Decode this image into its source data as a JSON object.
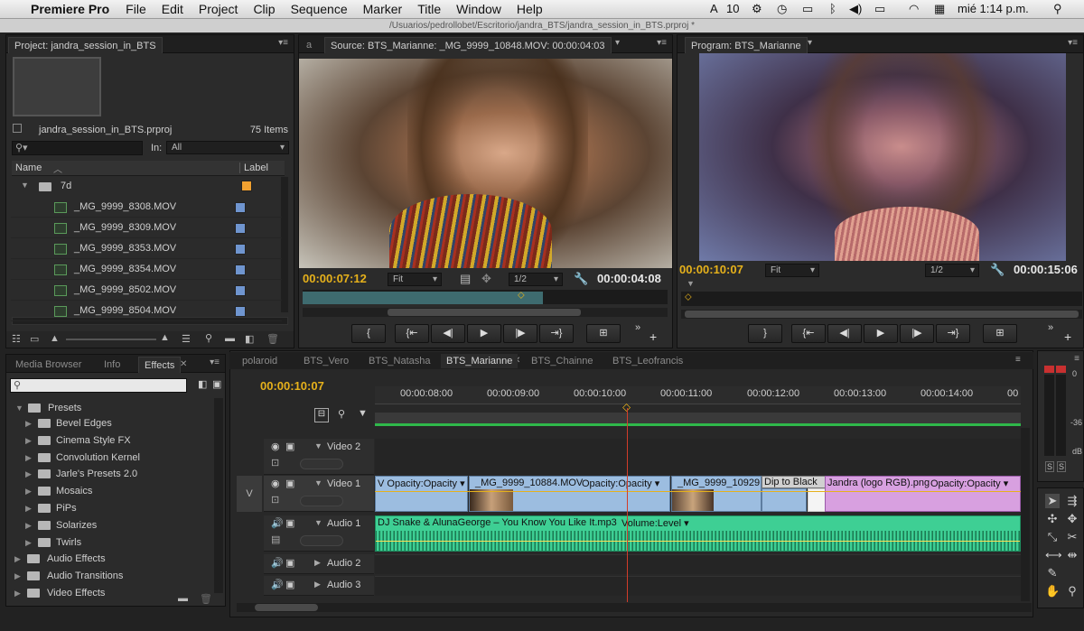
{
  "menubar": {
    "app_name": "Premiere Pro",
    "items": [
      "File",
      "Edit",
      "Project",
      "Clip",
      "Sequence",
      "Marker",
      "Title",
      "Window",
      "Help"
    ],
    "status_adobe": "10",
    "clock": "mié 1:14 p.m."
  },
  "window_title": "/Usuarios/pedrollobet/Escritorio/jandra_BTS/jandra_session_in_BTS.prproj *",
  "project": {
    "tab": "Project: jandra_session_in_BTS",
    "file": "jandra_session_in_BTS.prproj",
    "count": "75 Items",
    "in_label": "In:",
    "in_value": "All",
    "col_name": "Name",
    "col_label": "Label",
    "folder": "7d",
    "folder_label_color": "#f0a030",
    "clip_label_color": "#6f95cf",
    "items": [
      "_MG_9999_8308.MOV",
      "_MG_9999_8309.MOV",
      "_MG_9999_8353.MOV",
      "_MG_9999_8354.MOV",
      "_MG_9999_8502.MOV",
      "_MG_9999_8504.MOV"
    ]
  },
  "source": {
    "tab": "Source: BTS_Marianne: _MG_9999_10848.MOV: 00:00:04:03",
    "timecode": "00:00:07:12",
    "fit": "Fit",
    "res": "1/2",
    "duration": "00:00:04:08"
  },
  "program": {
    "tab": "Program: BTS_Marianne",
    "timecode": "00:00:10:07",
    "fit": "Fit",
    "res": "1/2",
    "duration": "00:00:15:06"
  },
  "effects": {
    "tabs": [
      "Media Browser",
      "Info",
      "Effects"
    ],
    "presets_label": "Presets",
    "presets": [
      "Bevel Edges",
      "Cinema Style FX",
      "Convolution Kernel",
      "Jarle's Presets 2.0",
      "Mosaics",
      "PiPs",
      "Solarizes",
      "Twirls"
    ],
    "categories": [
      "Audio Effects",
      "Audio Transitions",
      "Video Effects"
    ]
  },
  "timeline": {
    "tabs": [
      "polaroid",
      "BTS_Vero",
      "BTS_Natasha",
      "BTS_Marianne",
      "BTS_Chainne",
      "BTS_Leofrancis"
    ],
    "active_tab": "BTS_Marianne",
    "timecode": "00:00:10:07",
    "ruler": [
      "00:00:08:00",
      "00:00:09:00",
      "00:00:10:00",
      "00:00:11:00",
      "00:00:12:00",
      "00:00:13:00",
      "00:00:14:00",
      "00"
    ],
    "tracks": {
      "video2": "Video 2",
      "video1": "Video 1",
      "audio1": "Audio 1",
      "audio2": "Audio 2",
      "audio3": "Audio 3",
      "v_label": "V"
    },
    "clips": {
      "c1": "V  Opacity:Opacity ▾",
      "c2": "_MG_9999_10884.MOV",
      "c2fx": "Opacity:Opacity ▾",
      "c3": "_MG_9999_10929.",
      "c4": "Dip to Black",
      "c5": "Jandra (logo RGB).png",
      "c5fx": "Opacity:Opacity ▾",
      "audio": "DJ Snake & AlunaGeorge – You Know You Like It.mp3",
      "audio_fx": "Volume:Level ▾"
    }
  },
  "meter": {
    "scale": [
      "0",
      "-36",
      "dB"
    ],
    "solo": [
      "S",
      "S"
    ]
  },
  "colors": {
    "timecode": "#e6b11b",
    "video_clip": "#9cbde0",
    "png_clip": "#d8a0e0",
    "audio_clip": "#3ecf94",
    "playhead": "#d23c2a"
  }
}
